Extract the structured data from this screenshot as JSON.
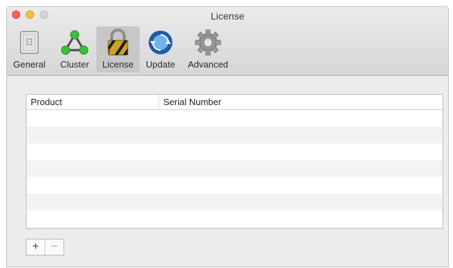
{
  "window": {
    "title": "License"
  },
  "toolbar": {
    "items": [
      {
        "label": "General",
        "icon": "general-icon"
      },
      {
        "label": "Cluster",
        "icon": "cluster-icon"
      },
      {
        "label": "License",
        "icon": "lock-icon",
        "selected": true
      },
      {
        "label": "Update",
        "icon": "update-icon"
      },
      {
        "label": "Advanced",
        "icon": "gear-icon"
      }
    ]
  },
  "table": {
    "columns": [
      "Product",
      "Serial Number"
    ],
    "rows": []
  },
  "buttons": {
    "add": "+",
    "remove": "−"
  },
  "colors": {
    "close": "#fc605b",
    "minimize": "#fdbc40",
    "zoom": "#d5d5d5"
  }
}
